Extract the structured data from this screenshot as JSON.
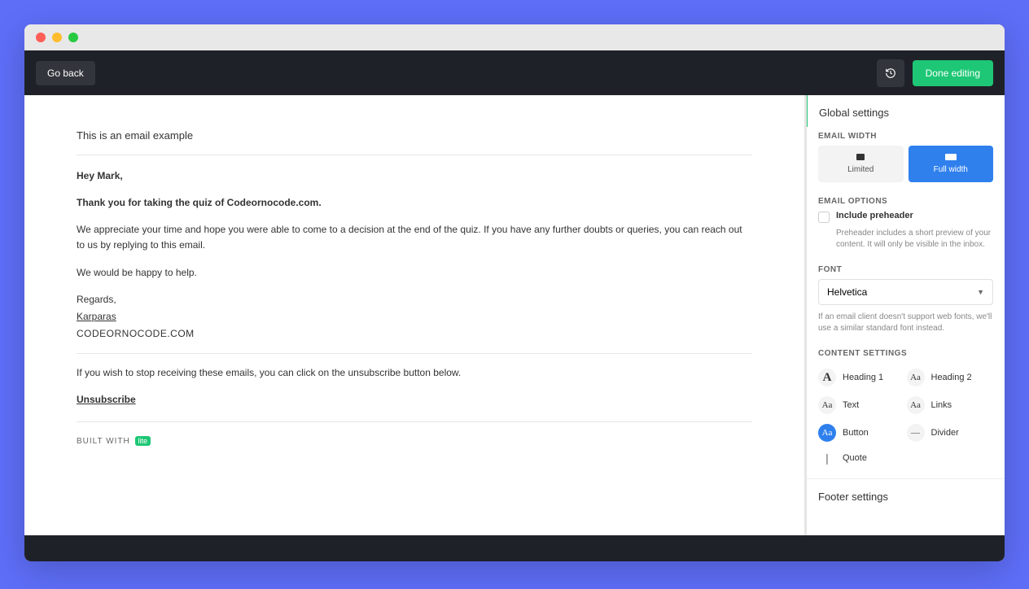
{
  "toolbar": {
    "go_back": "Go back",
    "done_editing": "Done editing"
  },
  "email": {
    "title": "This is an email example",
    "greeting": "Hey Mark,",
    "thanks": "Thank you for taking the quiz of Codeornocode.com.",
    "appreciate": "We appreciate your time and hope you were able to come to a decision at the end of the quiz. If you have any further doubts or queries, you can reach out to us by replying to this email.",
    "happy": "We would be happy to help.",
    "regards": "Regards,",
    "sender": "Karparas",
    "company": "CODEORNOCODE.COM",
    "stop_note": "If you wish to stop receiving these emails, you can click on the unsubscribe button below.",
    "unsubscribe": "Unsubscribe",
    "built_with": "BUILT WITH",
    "lite": "lite"
  },
  "sidebar": {
    "global_settings": "Global settings",
    "email_width_label": "EMAIL WIDTH",
    "width_limited": "Limited",
    "width_full": "Full width",
    "email_options_label": "EMAIL OPTIONS",
    "include_preheader": "Include preheader",
    "preheader_desc": "Preheader includes a short preview of your content. It will only be visible in the inbox.",
    "font_label": "FONT",
    "font_value": "Helvetica",
    "font_note": "If an email client doesn't support web fonts, we'll use a similar standard font instead.",
    "content_settings_label": "CONTENT SETTINGS",
    "cs": {
      "heading1": "Heading 1",
      "heading2": "Heading 2",
      "text": "Text",
      "links": "Links",
      "button": "Button",
      "divider": "Divider",
      "quote": "Quote"
    },
    "footer_settings": "Footer settings"
  }
}
